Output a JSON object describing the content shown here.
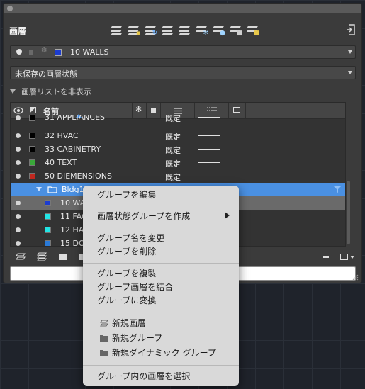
{
  "palette": {
    "title": "画層",
    "current_layer": "10 WALLS",
    "layer_state": "未保存の画層状態",
    "toggle_label": "画層リストを非表示"
  },
  "toolbar_icons": [
    "new-property-filter-icon",
    "new-group-filter-icon",
    "layer-states-manager-icon",
    "new-layer-icon",
    "new-layer-vp-frozen-icon",
    "delete-layer-icon",
    "set-current-icon",
    "refresh-icon",
    "settings-icon"
  ],
  "table": {
    "headers": {
      "name": "名前"
    },
    "rows": [
      {
        "name": "31 APPLIANCES",
        "state": "既定",
        "color": "#000000"
      },
      {
        "name": "32 HVAC",
        "state": "既定",
        "color": "#000000"
      },
      {
        "name": "33 CABINETRY",
        "state": "既定",
        "color": "#000000"
      },
      {
        "name": "40 TEXT",
        "state": "既定",
        "color": "#3aa83a"
      },
      {
        "name": "50 DIEMENSIONS",
        "state": "既定",
        "color": "#c0281f"
      },
      {
        "name": "Bldg1",
        "state": "",
        "color": ""
      },
      {
        "name": "10 WAL",
        "state": "",
        "color": "#1c3ccf"
      },
      {
        "name": "11 FAC",
        "state": "",
        "color": "#22e5e5"
      },
      {
        "name": "12 HAT",
        "state": "",
        "color": "#22e5e5"
      },
      {
        "name": "15 DOC",
        "state": "",
        "color": "#2a7ad8"
      }
    ]
  },
  "context_menu": {
    "edit_group": "グループを編集",
    "create_state_group": "画層状態グループを作成",
    "rename_group": "グループ名を変更",
    "delete_group": "グループを削除",
    "duplicate_group": "グループを複製",
    "merge_group_layers": "グループ画層を結合",
    "convert_group": "グループに変換",
    "new_layer": "新規画層",
    "new_group": "新規グループ",
    "new_dynamic_group": "新規ダイナミック グループ",
    "select_layers_in_group": "グループ内の画層を選択"
  },
  "colors": {
    "selection": "#4a90e2",
    "current_row": "#6a6a6a",
    "panel": "#3b3b3b"
  }
}
